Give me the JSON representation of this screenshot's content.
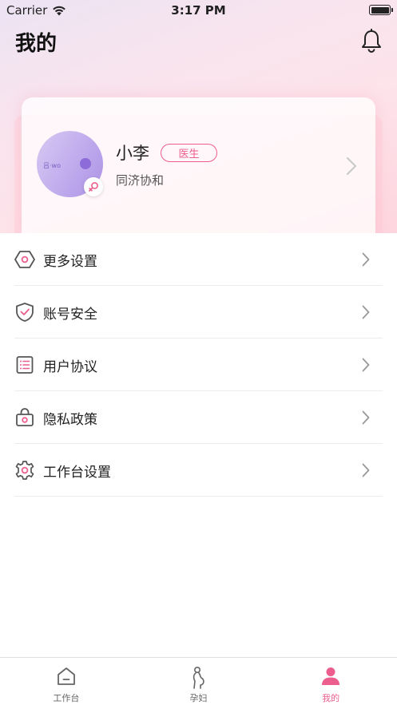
{
  "status_bar": {
    "carrier": "Carrier",
    "time": "3:17 PM"
  },
  "header": {
    "title": "我的"
  },
  "profile": {
    "name": "小李",
    "role": "医生",
    "hospital": "同济协和",
    "avatar_text": "吕·wo"
  },
  "menu": {
    "items": [
      {
        "label": "更多设置",
        "icon": "hexagon-settings-icon"
      },
      {
        "label": "账号安全",
        "icon": "shield-check-icon"
      },
      {
        "label": "用户协议",
        "icon": "document-list-icon"
      },
      {
        "label": "隐私政策",
        "icon": "lock-bag-icon"
      },
      {
        "label": "工作台设置",
        "icon": "gear-icon"
      }
    ]
  },
  "tab_bar": {
    "tabs": [
      {
        "label": "工作台",
        "icon": "home-icon"
      },
      {
        "label": "孕妇",
        "icon": "pregnant-icon"
      },
      {
        "label": "我的",
        "icon": "person-icon"
      }
    ],
    "active_index": 2
  },
  "colors": {
    "accent": "#ec5e8e",
    "text": "#222222",
    "divider": "#ececec"
  }
}
